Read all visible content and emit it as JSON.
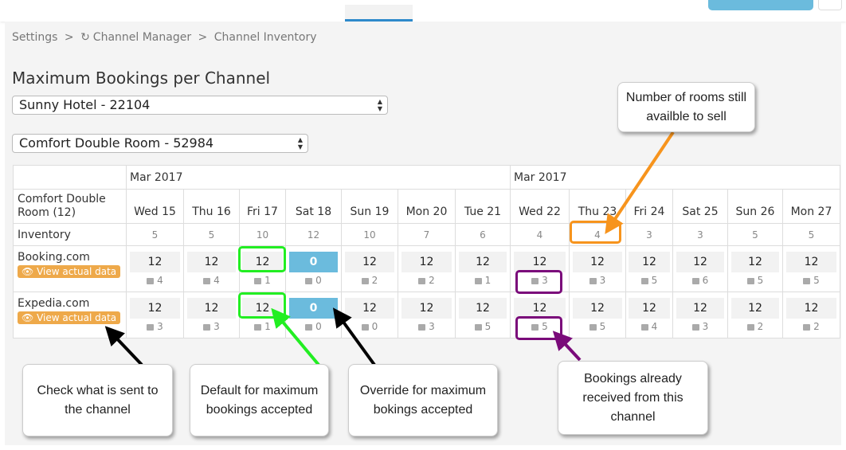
{
  "breadcrumb": {
    "items": [
      "Settings",
      "Channel Manager",
      "Channel Inventory"
    ],
    "separator": ">"
  },
  "page_title": "Maximum Bookings per Channel",
  "hotel_select": {
    "value": "Sunny Hotel - 22104"
  },
  "room_select": {
    "value": "Comfort Double Room - 52984"
  },
  "table": {
    "months": [
      "Mar 2017",
      "Mar 2017"
    ],
    "room_label": "Comfort Double Room (12)",
    "dates": [
      "Wed 15",
      "Thu 16",
      "Fri 17",
      "Sat 18",
      "Sun 19",
      "Mon 20",
      "Tue 21",
      "Wed 22",
      "Thu 23",
      "Fri 24",
      "Sat 25",
      "Sun 26",
      "Mon 27"
    ],
    "inventory_label": "Inventory",
    "inventory": [
      "5",
      "5",
      "10",
      "12",
      "10",
      "7",
      "6",
      "4",
      "4",
      "3",
      "3",
      "5",
      "5"
    ],
    "channels": [
      {
        "name": "Booking.com",
        "button": "View actual data",
        "max": [
          "12",
          "12",
          "12",
          "0",
          "12",
          "12",
          "12",
          "12",
          "12",
          "12",
          "12",
          "12",
          "12"
        ],
        "booked": [
          "4",
          "4",
          "1",
          "0",
          "2",
          "2",
          "1",
          "3",
          "3",
          "5",
          "6",
          "5",
          "5"
        ]
      },
      {
        "name": "Expedia.com",
        "button": "View actual data",
        "max": [
          "12",
          "12",
          "12",
          "0",
          "12",
          "12",
          "12",
          "12",
          "12",
          "12",
          "12",
          "12",
          "12"
        ],
        "booked": [
          "3",
          "3",
          "1",
          "0",
          "0",
          "3",
          "5",
          "5",
          "5",
          "4",
          "3",
          "2",
          "2"
        ]
      }
    ],
    "override_index": 3
  },
  "callouts": {
    "rooms_available": "Number of rooms still availble to sell",
    "check_sent": "Check what is sent to the channel",
    "default_max": "Default for maximum bookings accepted",
    "override_max": "Override for maximum bokings accepted",
    "bookings_received": "Bookings already received from this channel"
  },
  "colors": {
    "accent": "#2d8acb",
    "override": "#6bbbdd",
    "view_button": "#eea94a",
    "orange": "#f7941d",
    "green": "#22ee22",
    "purple": "#7a0a7a"
  }
}
